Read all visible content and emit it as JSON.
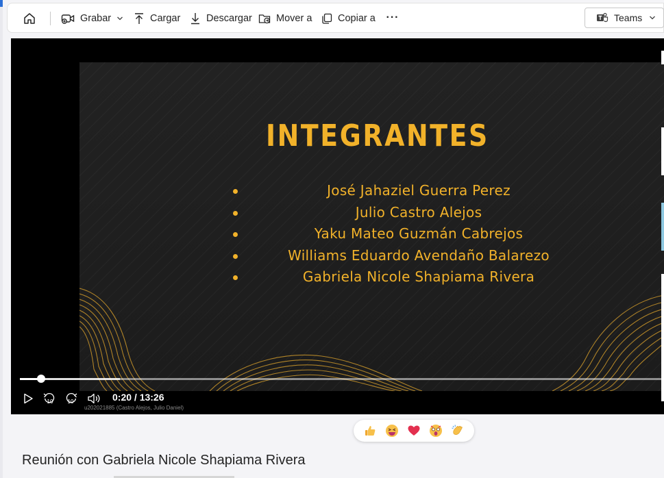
{
  "toolbar": {
    "home_icon": "home-icon",
    "record_label": "Grabar",
    "upload_label": "Cargar",
    "download_label": "Descargar",
    "move_label": "Mover a",
    "copy_label": "Copiar a",
    "more_label": "···",
    "teams_label": "Teams"
  },
  "slide": {
    "title": "INTEGRANTES",
    "members": [
      "José Jahaziel Guerra Perez",
      "Julio Castro Alejos",
      "Yaku Mateo Guzmán Cabrejos",
      "Williams Eduardo Avendaño Balarezo",
      "Gabriela Nicole Shapiama Rivera"
    ],
    "accent_color": "#f2b22a"
  },
  "player": {
    "time_display": "0:20 / 13:26",
    "progress_fraction": 0.025,
    "caption": "u202021885 (Castro Alejos, Julio Daniel)",
    "skip_back_label": "10",
    "skip_forward_label": "10"
  },
  "reactions": [
    "thumbs-up",
    "laugh",
    "heart",
    "surprised",
    "clap"
  ],
  "meeting": {
    "title": "Reunión con Gabriela Nicole Shapiama Rivera"
  }
}
